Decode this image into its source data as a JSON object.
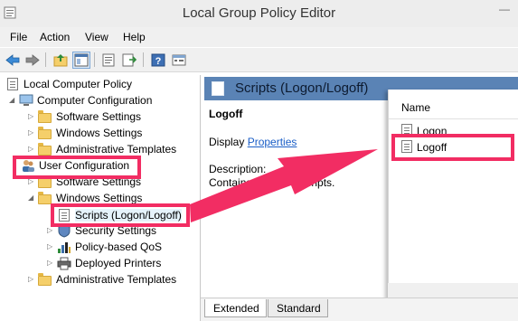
{
  "window": {
    "title": "Local Group Policy Editor",
    "minimize_glyph": "—"
  },
  "menu": {
    "items": [
      "File",
      "Action",
      "View",
      "Help"
    ]
  },
  "toolbar": {
    "icons": [
      "back-arrow-icon",
      "forward-arrow-icon",
      "up-folder-icon",
      "show-hide-tree-icon",
      "properties-icon",
      "export-list-icon",
      "help-icon",
      "filter-icon"
    ]
  },
  "tree": {
    "root": "Local Computer Policy",
    "computer_configuration": "Computer Configuration",
    "cc_software_settings": "Software Settings",
    "cc_windows_settings": "Windows Settings",
    "cc_admin_templates": "Administrative Templates",
    "user_configuration": "User Configuration",
    "uc_software_settings": "Software Settings",
    "uc_windows_settings": "Windows Settings",
    "scripts": "Scripts (Logon/Logoff)",
    "security_settings": "Security Settings",
    "policy_qos": "Policy-based QoS",
    "deployed_printers": "Deployed Printers",
    "uc_admin_templates": "Administrative Templates"
  },
  "content": {
    "header_title": "Scripts (Logon/Logoff)",
    "selected_heading": "Logoff",
    "display_prefix": "Display",
    "properties_link": "Properties",
    "description_label": "Description:",
    "description_value": "Contains u",
    "description_value_tail": "cripts."
  },
  "list": {
    "column_name": "Name",
    "items": [
      "Logon",
      "Logoff"
    ]
  },
  "tabs": {
    "extended": "Extended",
    "standard": "Standard"
  },
  "colors": {
    "highlight": "#f22d63",
    "content_header": "#5a83b5",
    "link": "#1a5ec7"
  }
}
